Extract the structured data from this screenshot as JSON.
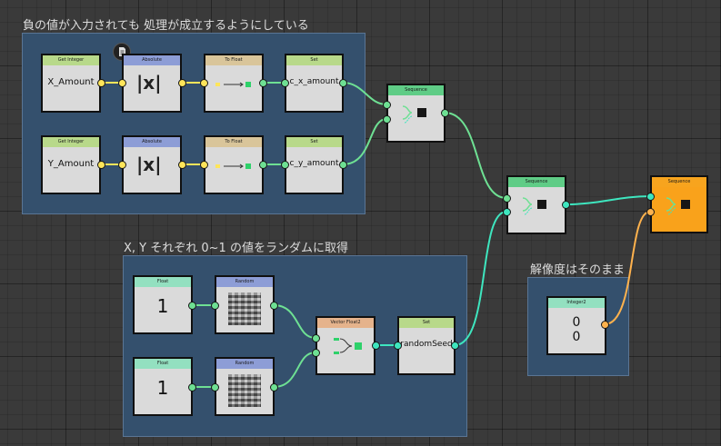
{
  "frames": {
    "abs_group_title": "負の値が入力されても 処理が成立するようにしている",
    "random_group_title": "X, Y それぞれ 0~1 の値をランダムに取得",
    "resolution_group_title": "解像度はそのまま"
  },
  "nodes": {
    "get_integer_x": {
      "header": "Get Integer",
      "value": "X_Amount"
    },
    "get_integer_y": {
      "header": "Get Integer",
      "value": "Y_Amount"
    },
    "absolute_x": {
      "header": "Absolute",
      "symbol": "|x|"
    },
    "absolute_y": {
      "header": "Absolute",
      "symbol": "|x|"
    },
    "to_float_x": {
      "header": "To Float"
    },
    "to_float_y": {
      "header": "To Float"
    },
    "set_cx": {
      "header": "Set",
      "value": "c_x_amount"
    },
    "set_cy": {
      "header": "Set",
      "value": "c_y_amount"
    },
    "sequence_1": {
      "header": "Sequence"
    },
    "sequence_2": {
      "header": "Sequence"
    },
    "sequence_3": {
      "header": "Sequence"
    },
    "float_1": {
      "header": "Float",
      "value": "1"
    },
    "float_2": {
      "header": "Float",
      "value": "1"
    },
    "random_1": {
      "header": "Random"
    },
    "random_2": {
      "header": "Random"
    },
    "vector_float2": {
      "header": "Vector Float2"
    },
    "set_random": {
      "header": "Set",
      "value": "randomSeed"
    },
    "integer2": {
      "header": "Integer2",
      "value_x": "0",
      "value_y": "0"
    }
  },
  "colors": {
    "background": "#3a3a3a",
    "frame": "#34506d",
    "wire_float": "#ffe55a",
    "wire_exec": "#6ee093",
    "wire_vector": "#3ee6bf",
    "wire_int2": "#ffb24d",
    "sequence_output_node": "#f9a21b"
  }
}
